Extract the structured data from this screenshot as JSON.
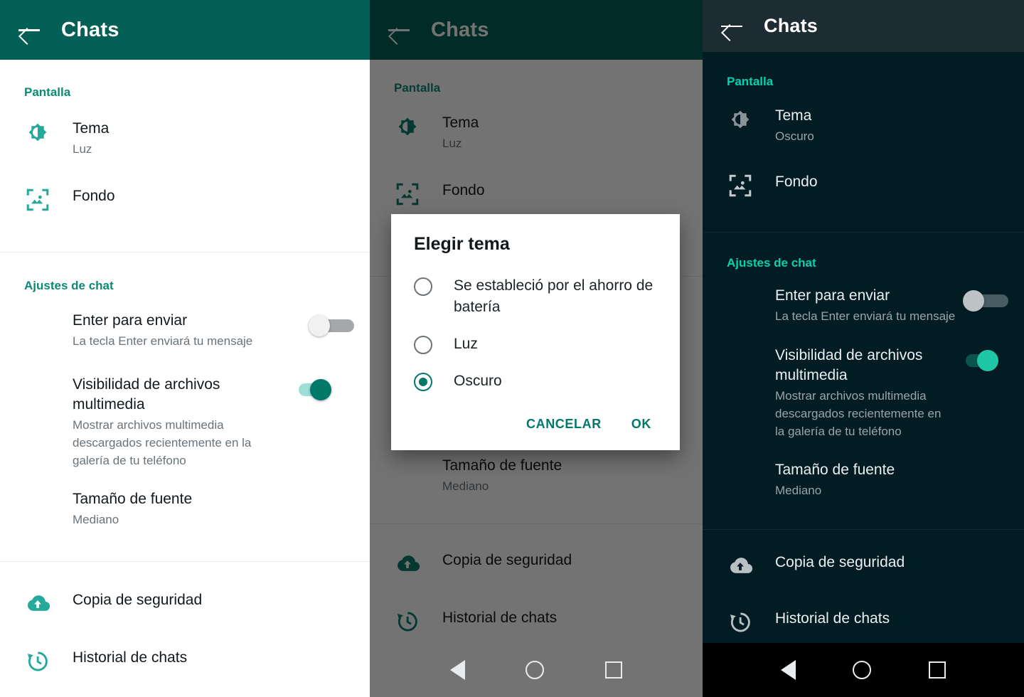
{
  "screens": [
    {
      "id": "light-theme-settings",
      "appbar": {
        "back_icon": "back-arrow-icon",
        "title": "Chats"
      },
      "sections": [
        {
          "header": "Pantalla",
          "rows": [
            {
              "icon": "brightness-icon",
              "title": "Tema",
              "sub": "Luz",
              "toggle": null
            },
            {
              "icon": "wallpaper-icon",
              "title": "Fondo",
              "sub": "",
              "toggle": null
            }
          ]
        },
        {
          "header": "Ajustes de chat",
          "rows": [
            {
              "icon": "",
              "title": "Enter para enviar",
              "sub": "La tecla Enter enviará tu mensaje",
              "toggle": "off"
            },
            {
              "icon": "",
              "title": "Visibilidad de archivos multimedia",
              "sub": "Mostrar archivos multimedia descargados recientemente en la galería de tu teléfono",
              "toggle": "on"
            },
            {
              "icon": "",
              "title": "Tamaño de fuente",
              "sub": "Mediano",
              "toggle": null
            }
          ]
        },
        {
          "header": "",
          "rows": [
            {
              "icon": "cloud-backup-icon",
              "title": "Copia de seguridad",
              "sub": "",
              "toggle": null
            },
            {
              "icon": "history-icon",
              "title": "Historial de chats",
              "sub": "",
              "toggle": null
            }
          ]
        }
      ]
    },
    {
      "id": "theme-dialog",
      "appbar": {
        "back_icon": "back-arrow-icon",
        "title": "Chats"
      },
      "sections": [
        {
          "header": "Pantalla",
          "rows": [
            {
              "icon": "brightness-icon",
              "title": "Tema",
              "sub": "Luz",
              "toggle": null
            },
            {
              "icon": "wallpaper-icon",
              "title": "Fondo",
              "sub": "",
              "toggle": null
            }
          ]
        },
        {
          "header": "",
          "rows": [
            {
              "icon": "",
              "title": "Tamaño de fuente",
              "sub": "Mediano",
              "toggle": null
            }
          ]
        },
        {
          "header": "",
          "rows": [
            {
              "icon": "cloud-backup-icon",
              "title": "Copia de seguridad",
              "sub": "",
              "toggle": null
            },
            {
              "icon": "history-icon",
              "title": "Historial de chats",
              "sub": "",
              "toggle": null
            }
          ]
        }
      ],
      "dialog": {
        "title": "Elegir tema",
        "options": [
          {
            "label": "Se estableció por el ahorro de batería",
            "selected": false
          },
          {
            "label": "Luz",
            "selected": false
          },
          {
            "label": "Oscuro",
            "selected": true
          }
        ],
        "cancel_label": "CANCELAR",
        "ok_label": "OK"
      },
      "navbar": {
        "back": "nav-back-icon",
        "home": "nav-home-icon",
        "recent": "nav-recent-icon"
      }
    },
    {
      "id": "dark-theme-settings",
      "appbar": {
        "back_icon": "back-arrow-icon",
        "title": "Chats"
      },
      "sections": [
        {
          "header": "Pantalla",
          "rows": [
            {
              "icon": "brightness-icon",
              "title": "Tema",
              "sub": "Oscuro",
              "toggle": null
            },
            {
              "icon": "wallpaper-icon",
              "title": "Fondo",
              "sub": "",
              "toggle": null
            }
          ]
        },
        {
          "header": "Ajustes de chat",
          "rows": [
            {
              "icon": "",
              "title": "Enter para enviar",
              "sub": "La tecla Enter enviará tu mensaje",
              "toggle": "off"
            },
            {
              "icon": "",
              "title": "Visibilidad de archivos multimedia",
              "sub": "Mostrar archivos multimedia descargados recientemente en la galería de tu teléfono",
              "toggle": "on"
            },
            {
              "icon": "",
              "title": "Tamaño de fuente",
              "sub": "Mediano",
              "toggle": null
            }
          ]
        },
        {
          "header": "",
          "rows": [
            {
              "icon": "cloud-backup-icon",
              "title": "Copia de seguridad",
              "sub": "",
              "toggle": null
            },
            {
              "icon": "history-icon",
              "title": "Historial de chats",
              "sub": "",
              "toggle": null
            }
          ]
        }
      ],
      "navbar": {
        "back": "nav-back-icon",
        "home": "nav-home-icon",
        "recent": "nav-recent-icon"
      }
    }
  ],
  "colors": {
    "appbar_green": "#046056",
    "appbar_dark": "#1D2B32",
    "dark_background": "#021C24",
    "accent_light": "#0b8a74",
    "accent_dark": "#00D3B0",
    "toggle_on_light": "#00796b",
    "toggle_on_dark": "#1fc7a9",
    "dialog_action": "#00796b"
  }
}
